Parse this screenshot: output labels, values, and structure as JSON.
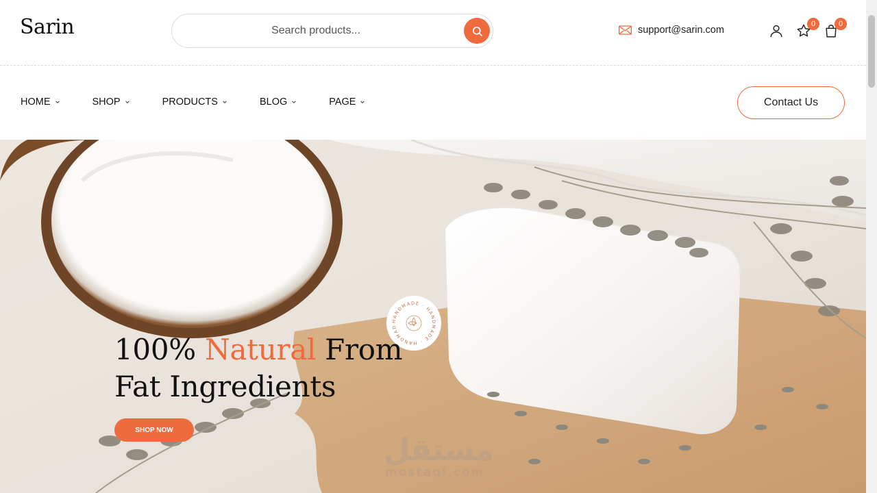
{
  "header": {
    "logo": "Sarin",
    "search_placeholder": "Search products...",
    "email": "support@sarin.com",
    "wishlist_count": "0",
    "cart_count": "0"
  },
  "nav": {
    "items": [
      {
        "label": "HOME"
      },
      {
        "label": "SHOP"
      },
      {
        "label": "PRODUCTS"
      },
      {
        "label": "BLOG"
      },
      {
        "label": "PAGE"
      }
    ],
    "contact_label": "Contact Us"
  },
  "hero": {
    "headline_part1": "100%",
    "headline_accent": "Natural",
    "headline_part2": "From",
    "headline_line2": "Fat Ingredients",
    "cta_label": "SHOP NOW",
    "stamp_text": "HANDMADE · HANDMADE · HANDMADE ·",
    "watermark": "مستقل",
    "watermark_sub": "mostaql.com"
  },
  "colors": {
    "accent": "#ef6a3c",
    "text": "#111111"
  },
  "icons": [
    "search-icon",
    "mail-icon",
    "user-icon",
    "star-icon",
    "bag-icon",
    "chevron-down-icon",
    "flower-icon"
  ]
}
